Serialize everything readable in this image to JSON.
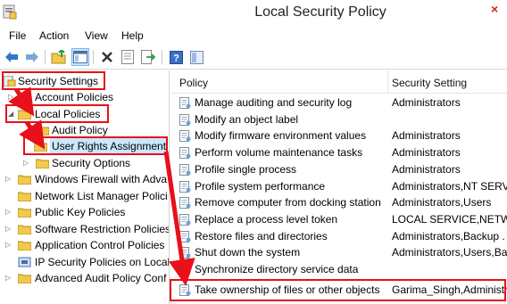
{
  "window": {
    "title": "Local Security Policy",
    "close_glyph": "×"
  },
  "menu": {
    "items": [
      "File",
      "Action",
      "View",
      "Help"
    ]
  },
  "toolbar": {
    "buttons": [
      "back-icon",
      "forward-icon",
      "up-folder-icon",
      "show-tree-icon",
      "delete-icon",
      "properties-icon",
      "export-icon",
      "help-icon",
      "mmc-icon"
    ]
  },
  "tree": {
    "root": "Security Settings",
    "items": [
      "Account Policies",
      "Local Policies",
      "Audit Policy",
      "User Rights Assignment",
      "Security Options",
      "Windows Firewall with Adva",
      "Network List Manager Polici",
      "Public Key Policies",
      "Software Restriction Policies",
      "Application Control Policies",
      "IP Security Policies on Local",
      "Advanced Audit Policy Conf"
    ]
  },
  "list": {
    "columns": [
      "Policy",
      "Security Setting"
    ],
    "rows": [
      {
        "policy": "Manage auditing and security log",
        "setting": "Administrators"
      },
      {
        "policy": "Modify an object label",
        "setting": ""
      },
      {
        "policy": "Modify firmware environment values",
        "setting": "Administrators"
      },
      {
        "policy": "Perform volume maintenance tasks",
        "setting": "Administrators"
      },
      {
        "policy": "Profile single process",
        "setting": "Administrators"
      },
      {
        "policy": "Profile system performance",
        "setting": "Administrators,NT SERVI"
      },
      {
        "policy": "Remove computer from docking station",
        "setting": "Administrators,Users"
      },
      {
        "policy": "Replace a process level token",
        "setting": "LOCAL SERVICE,NETWO"
      },
      {
        "policy": "Restore files and directories",
        "setting": "Administrators,Backup ."
      },
      {
        "policy": "Shut down the system",
        "setting": "Administrators,Users,Ba."
      },
      {
        "policy": "Synchronize directory service data",
        "setting": ""
      },
      {
        "policy": "Take ownership of files or other objects",
        "setting": "Garima_Singh,Administr"
      }
    ]
  },
  "colors": {
    "annotation_red": "#e8101a",
    "selection_blue": "#cce8ff",
    "folder_yellow": "#f2c94c"
  }
}
